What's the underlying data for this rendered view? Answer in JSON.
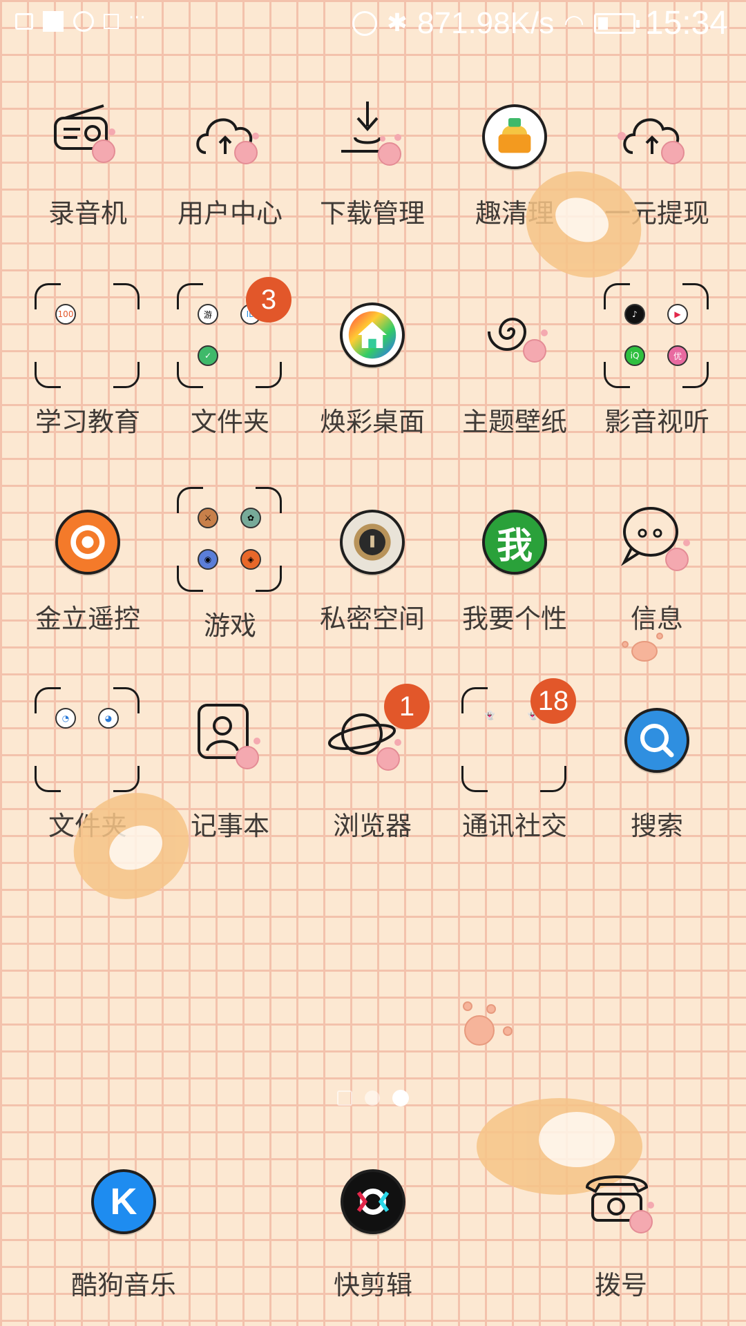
{
  "status_bar": {
    "net_speed": "871.98K/s",
    "time": "15:34"
  },
  "apps_row1": [
    {
      "label": "录音机",
      "icon": "radio-icon"
    },
    {
      "label": "用户中心",
      "icon": "cloud-user-icon"
    },
    {
      "label": "下载管理",
      "icon": "download-icon"
    },
    {
      "label": "趣清理",
      "icon": "broom-cleaner-icon"
    },
    {
      "label": "一元提现",
      "icon": "cloud-cash-icon"
    }
  ],
  "apps_row2": [
    {
      "label": "学习教育",
      "folder": true
    },
    {
      "label": "文件夹",
      "folder": true,
      "badge": "3"
    },
    {
      "label": "焕彩桌面",
      "icon": "home-icon"
    },
    {
      "label": "主题壁纸",
      "icon": "spiral-icon"
    },
    {
      "label": "影音视听",
      "folder": true
    }
  ],
  "apps_row3": [
    {
      "label": "金立遥控",
      "icon": "remote-icon"
    },
    {
      "label": "游戏",
      "folder": true
    },
    {
      "label": "私密空间",
      "icon": "lock-icon"
    },
    {
      "label": "我要个性",
      "icon": "wo-icon",
      "text": "我"
    },
    {
      "label": "信息",
      "icon": "message-icon"
    }
  ],
  "apps_row4": [
    {
      "label": "文件夹",
      "folder": true
    },
    {
      "label": "记事本",
      "icon": "notepad-icon"
    },
    {
      "label": "浏览器",
      "icon": "planet-icon",
      "badge": "1"
    },
    {
      "label": "通讯社交",
      "folder": true,
      "badge": "18"
    },
    {
      "label": "搜索",
      "icon": "search-icon"
    }
  ],
  "dock": [
    {
      "label": "酷狗音乐",
      "icon": "kugou-icon",
      "text": "K"
    },
    {
      "label": "快剪辑",
      "icon": "clip-icon"
    },
    {
      "label": "拨号",
      "icon": "phone-icon"
    }
  ],
  "folder_contents": {
    "study": [
      "100"
    ],
    "files": [
      "游",
      "ID",
      "✓"
    ],
    "media": [
      "♪",
      "▶",
      "iQ",
      "优"
    ],
    "games": [
      "⚔",
      "✿",
      "◉",
      "◈"
    ],
    "files2": [
      "◔",
      "◕"
    ],
    "social": [
      "👻",
      "👻"
    ]
  },
  "colors": {
    "background": "#fce8d2",
    "grid": "#f3c2ac",
    "badge": "#e2572a",
    "label": "#3f3a36"
  }
}
